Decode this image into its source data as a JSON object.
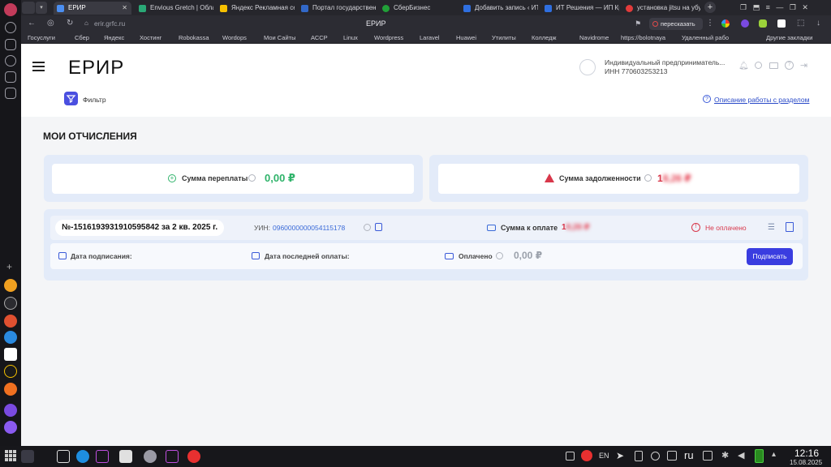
{
  "browser": {
    "tabs": [
      {
        "label": "ЕРИР",
        "color": "#4b8ef0"
      },
      {
        "label": "Envious Gretch | Облач",
        "color": "#2aa876"
      },
      {
        "label": "Яндекс Рекламная сет",
        "color": "#f5c000"
      },
      {
        "label": "Портал государственн",
        "color": "#3268c8"
      },
      {
        "label": "СберБизнес",
        "color": "#21a038"
      },
      {
        "label": "Добавить запись ‹ ИТ Р",
        "color": "#2f6fe0"
      },
      {
        "label": "ИТ Решения — ИП Крас",
        "color": "#2f6fe0"
      },
      {
        "label": "установка jitsu на убун",
        "color": "#e23b3b"
      }
    ],
    "url": "erir.grfc.ru",
    "page_title": "ЕРИР",
    "translate_label": "пересказать",
    "bookmarks": [
      "Госуслуги",
      "Сбер",
      "Яндекс",
      "Хостинг",
      "Robokassa",
      "Wordops",
      "Мои Сайты",
      "АССР",
      "Linux",
      "Wordpress",
      "Laravel",
      "Huawei",
      "Утилиты",
      "Колледж",
      "Navidrome",
      "https://bolotnaya",
      "Удаленный рабо",
      "Другие закладки"
    ]
  },
  "header": {
    "logo": "ЕРИР",
    "user_name": "Индивидуальный предприниматель...",
    "user_inn": "ИНН 770603253213",
    "filter_label": "Фильтр",
    "help_link": "Описание работы с разделом"
  },
  "main": {
    "page_title": "МОИ ОТЧИСЛЕНИЯ",
    "overpay_label": "Сумма переплаты",
    "overpay_value": "0,00 ₽",
    "debt_label": "Сумма задолженности",
    "debt_value": "1",
    "debt_value_blur": "8,26 ₽",
    "record": {
      "number": "№-1516193931910595842 за 2 кв. 2025 г.",
      "uin_label": "УИН:",
      "uin_value": "0960000000054115178",
      "pay_label": "Сумма к оплате",
      "pay_value": "1",
      "pay_value_blur": "8,26 ₽",
      "status": "Не оплачено",
      "sign_date_label": "Дата подписания:",
      "last_pay_label": "Дата последней оплаты:",
      "paid_label": "Оплачено",
      "paid_value": "0,00 ₽",
      "sign_button": "Подписать"
    }
  },
  "taskbar": {
    "lang": "EN",
    "lang2": "ru",
    "time": "12:16",
    "date": "15.08.2025"
  }
}
